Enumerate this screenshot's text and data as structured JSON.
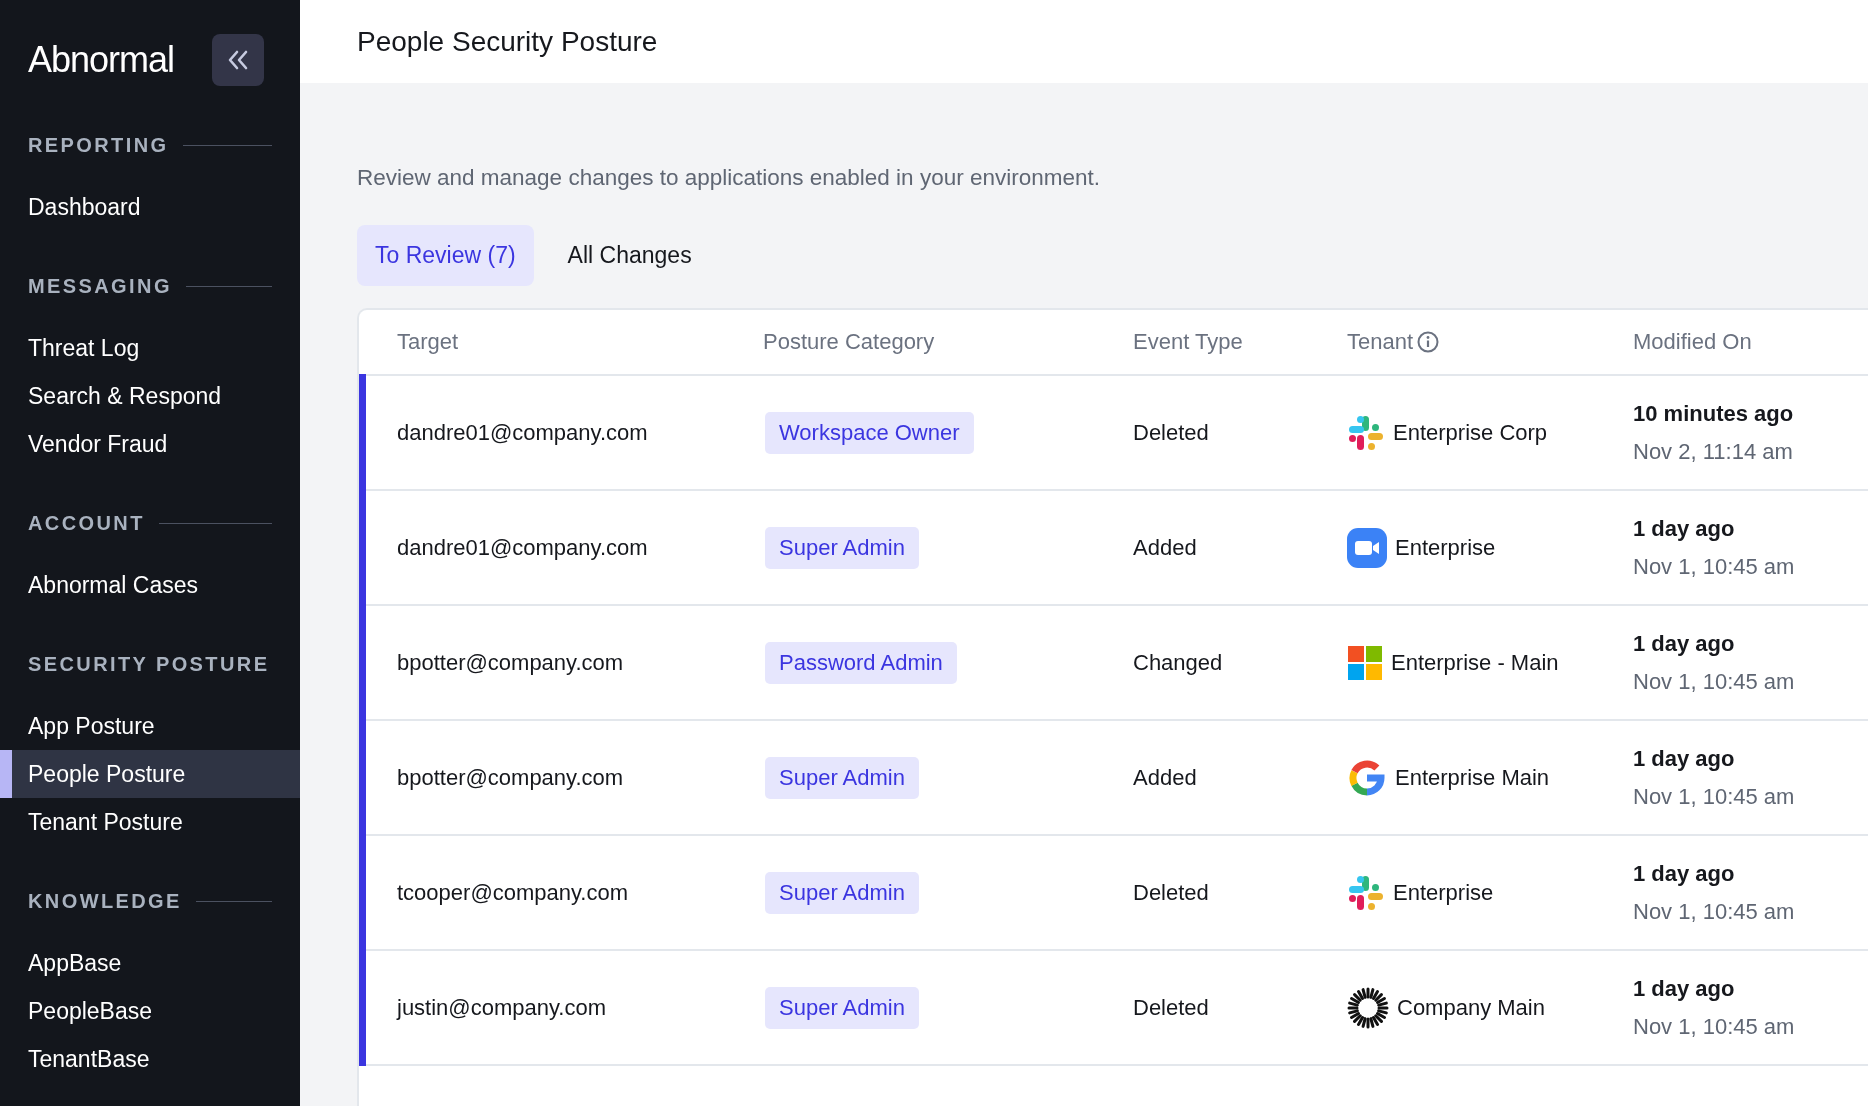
{
  "sidebar": {
    "logo": "Abnormal",
    "sections": [
      {
        "heading": "REPORTING",
        "items": [
          {
            "label": "Dashboard",
            "selected": false
          }
        ]
      },
      {
        "heading": "MESSAGING",
        "items": [
          {
            "label": "Threat Log",
            "selected": false
          },
          {
            "label": "Search & Respond",
            "selected": false
          },
          {
            "label": "Vendor Fraud",
            "selected": false
          }
        ]
      },
      {
        "heading": "ACCOUNT",
        "items": [
          {
            "label": "Abnormal Cases",
            "selected": false
          }
        ]
      },
      {
        "heading": "SECURITY POSTURE",
        "items": [
          {
            "label": "App Posture",
            "selected": false
          },
          {
            "label": "People Posture",
            "selected": true
          },
          {
            "label": "Tenant Posture",
            "selected": false
          }
        ]
      },
      {
        "heading": "KNOWLEDGE",
        "items": [
          {
            "label": "AppBase",
            "selected": false
          },
          {
            "label": "PeopleBase",
            "selected": false
          },
          {
            "label": "TenantBase",
            "selected": false
          }
        ]
      }
    ]
  },
  "page": {
    "title": "People Security Posture",
    "description": "Review and manage changes to applications enabled in your environment."
  },
  "tabs": [
    {
      "label": "To Review (7)",
      "selected": true
    },
    {
      "label": "All Changes",
      "selected": false
    }
  ],
  "table": {
    "columns": [
      "Target",
      "Posture Category",
      "Event Type",
      "Tenant",
      "Modified On"
    ],
    "rows": [
      {
        "target": "dandre01@company.com",
        "category": "Workspace Owner",
        "event": "Deleted",
        "kind": "hash",
        "tenant": "Enterprise Corp",
        "ago": "10 minutes ago",
        "date": "Nov 2, 11:14 am",
        "unreviewed": true
      },
      {
        "target": "dandre01@company.com",
        "category": "Super Admin",
        "event": "Added",
        "kind": "video",
        "tenant": "Enterprise",
        "ago": "1 day ago",
        "date": "Nov 1, 10:45 am",
        "unreviewed": true
      },
      {
        "target": "bpotter@company.com",
        "category": "Password Admin",
        "event": "Changed",
        "kind": "squares",
        "tenant": "Enterprise - Main",
        "ago": "1 day ago",
        "date": "Nov 1, 10:45 am",
        "unreviewed": true
      },
      {
        "target": "bpotter@company.com",
        "category": "Super Admin",
        "event": "Added",
        "kind": "g",
        "tenant": "Enterprise Main",
        "ago": "1 day ago",
        "date": "Nov 1, 10:45 am",
        "unreviewed": true
      },
      {
        "target": "tcooper@company.com",
        "category": "Super Admin",
        "event": "Deleted",
        "kind": "hash",
        "tenant": "Enterprise",
        "ago": "1 day ago",
        "date": "Nov 1, 10:45 am",
        "unreviewed": true
      },
      {
        "target": "justin@company.com",
        "category": "Super Admin",
        "event": "Deleted",
        "kind": "sunburst",
        "tenant": "Company Main",
        "ago": "1 day ago",
        "date": "Nov 1, 10:45 am",
        "unreviewed": true
      }
    ]
  }
}
